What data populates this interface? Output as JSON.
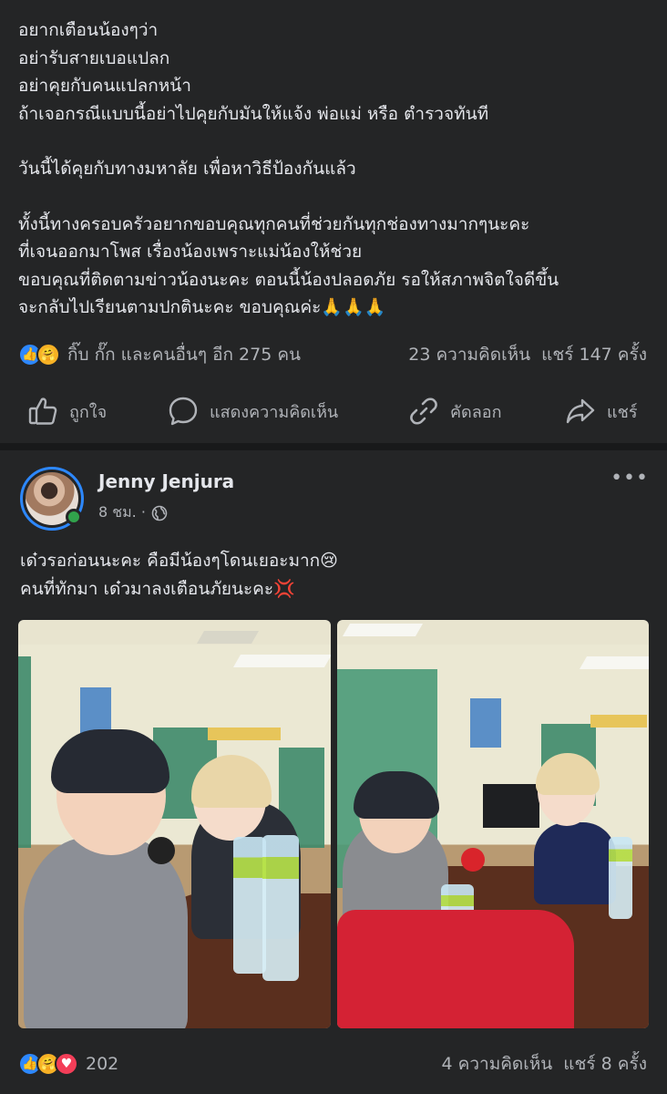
{
  "post1": {
    "lines": [
      "อยากเตือนน้องๆว่า",
      "อย่ารับสายเบอแปลก",
      "อย่าคุยกับคนแปลกหน้า",
      "ถ้าเจอกรณีแบบนี้อย่าไปคุยกับมันให้แจ้ง พ่อแม่ หรือ ตำรวจทันที",
      "",
      "วันนี้ได้คุยกับทางมหาลัย เพื่อหาวิธีป้องกันแล้ว",
      "",
      "ทั้งนี้ทางครอบครัวอยากขอบคุณทุกคนที่ช่วยกันทุกช่องทางมากๆนะคะ",
      "ที่เจนออกมาโพส เรื่องน้องเพราะแม่น้องให้ช่วย",
      "ขอบคุณที่ติดตามข่าวน้องนะคะ ตอนนี้น้องปลอดภัย รอให้สภาพจิตใจดีขึ้น"
    ],
    "last_line": "จะกลับไปเรียนตามปกตินะคะ ขอบคุณค่ะ",
    "last_line_emoji": "🙏🙏🙏",
    "reactions_text": "กิ๊บ กั๊ก และคนอื่นๆ อีก 275 คน",
    "comments": "23 ความคิดเห็น",
    "shares": "แชร์ 147 ครั้ง",
    "actions": {
      "like": "ถูกใจ",
      "comment": "แสดงความคิดเห็น",
      "copy": "คัดลอก",
      "share": "แชร์"
    }
  },
  "post2": {
    "author": "Jenny Jenjura",
    "time": "8 ชม. ·",
    "line1": "เด๋วรอก่อนนะคะ คือมีน้องๆโดนเยอะมาก",
    "line1_emoji": "😢",
    "line2": "คนที่ทักมา เด๋วมาลงเตือนภัยนะคะ",
    "line2_emoji": "💢",
    "reactions_count": "202",
    "comments": "4 ความคิดเห็น",
    "shares": "แชร์ 8 ครั้ง"
  },
  "colors": {
    "background": "#242526",
    "separator": "#18191a",
    "text": "#e4e6eb",
    "secondary_text": "#b0b3b8",
    "like_blue": "#2d88ff",
    "online_green": "#31a24c"
  }
}
